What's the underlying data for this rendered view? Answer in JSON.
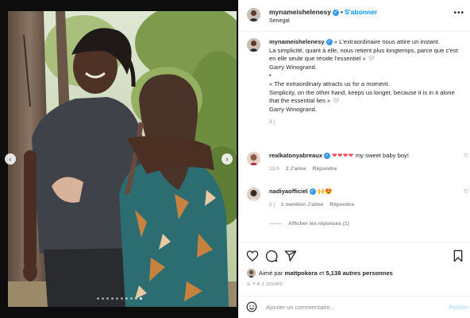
{
  "header": {
    "username": "mynameishelenesy",
    "separator": "•",
    "follow_label": "S'abonner",
    "location": "Senegal",
    "more_icon": "more-horizontal-icon"
  },
  "caption": {
    "username": "mynameishelenesy",
    "lines": [
      "« L'extraordinaire nous attire un instant.",
      "La simplicité, quant à elle, nous retient plus longtemps, parce que c'est en elle seule que réside l'essentiel » 🤍",
      "Garry Winogrand.",
      "•",
      "« The extraordinary attracts us for a moment.",
      "Simplicity, on the other hand, keeps us longer, because it is in it alone that the essential lies » 🤍",
      "Garry Winogrand."
    ],
    "time": "3 j"
  },
  "comments": [
    {
      "username": "realkatonyabreaux",
      "text": "my sweet baby boy!",
      "emoji": "❤❤❤❤",
      "time": "13 h",
      "likes": "2 J'aime",
      "reply_label": "Répondre"
    },
    {
      "username": "nadiyaofficiel",
      "text": "",
      "emoji": "🙌😍",
      "time": "2 j",
      "likes": "1 mention J'aime",
      "reply_label": "Répondre",
      "view_replies": "Afficher les réponses (1)"
    }
  ],
  "actions": {
    "like_icon": "heart-icon",
    "comment_icon": "comment-icon",
    "share_icon": "send-icon",
    "save_icon": "bookmark-icon"
  },
  "likes": {
    "prefix": "Aimé par",
    "user": "mattpokora",
    "connector": "et",
    "count": "5,138 autres personnes"
  },
  "post_date": "IL Y A 3 JOURS",
  "add_comment": {
    "placeholder": "Ajouter un commentaire...",
    "publish_label": "Publier"
  },
  "carousel": {
    "total_slides": 10,
    "active_slide": 10
  },
  "colors": {
    "accent": "#0095f6",
    "verified": "#3897f0",
    "muted": "#8e8e8e",
    "heart": "#ed4956"
  }
}
